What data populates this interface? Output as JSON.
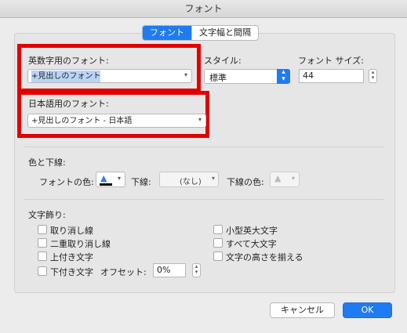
{
  "window": {
    "title": "フォント"
  },
  "tabs": [
    {
      "label": "フォント",
      "active": true
    },
    {
      "label": "文字幅と間隔",
      "active": false
    }
  ],
  "latin_font": {
    "label": "英数字用のフォント:",
    "value": "+見出しのフォント"
  },
  "style": {
    "label": "スタイル:",
    "value": "標準"
  },
  "size": {
    "label": "フォント サイズ:",
    "value": "44"
  },
  "asian_font": {
    "label": "日本語用のフォント:",
    "value": "+見出しのフォント - 日本語"
  },
  "color_underline": {
    "section_label": "色と下線:",
    "font_color_label": "フォントの色:",
    "underline_label": "下線:",
    "underline_value": "(なし)",
    "underline_color_label": "下線の色:"
  },
  "effects": {
    "section_label": "文字飾り:",
    "left": [
      {
        "label": "取り消し線",
        "checked": false
      },
      {
        "label": "二重取り消し線",
        "checked": false
      },
      {
        "label": "上付き文字",
        "checked": false
      },
      {
        "label": "下付き文字",
        "checked": false
      }
    ],
    "offset_label": "オフセット:",
    "offset_value": "0%",
    "right": [
      {
        "label": "小型英大文字",
        "checked": false
      },
      {
        "label": "すべて大文字",
        "checked": false
      },
      {
        "label": "文字の高さを揃える",
        "checked": false
      }
    ]
  },
  "buttons": {
    "cancel": "キャンセル",
    "ok": "OK"
  },
  "colors": {
    "accent": "#1f7bf1",
    "highlight_box": "#e00000",
    "font_color": "#000000"
  }
}
